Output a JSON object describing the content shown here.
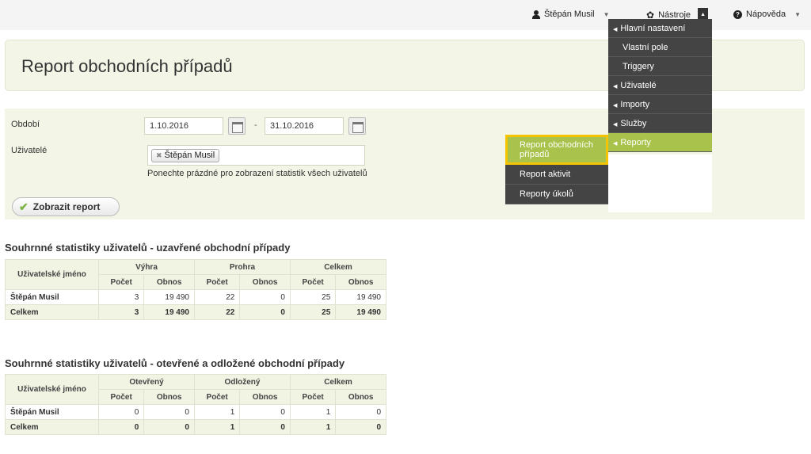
{
  "topbar": {
    "user_name": "Štěpán Musil",
    "tools_label": "Nástroje",
    "help_label": "Nápověda"
  },
  "page": {
    "title": "Report obchodních případů"
  },
  "filter": {
    "period_label": "Období",
    "date_from": "1.10.2016",
    "date_separator": "-",
    "date_to": "31.10.2016",
    "users_label": "Uživatelé",
    "selected_user": "Štěpán Musil",
    "hint": "Ponechte prázdné pro zobrazení statistik všech uživatelů",
    "submit_label": "Zobrazit report"
  },
  "tools_menu": {
    "items": [
      {
        "label": "Hlavní nastavení",
        "submenu": true
      },
      {
        "label": "Vlastní pole",
        "submenu": false
      },
      {
        "label": "Triggery",
        "submenu": false
      },
      {
        "label": "Uživatelé",
        "submenu": true
      },
      {
        "label": "Importy",
        "submenu": true
      },
      {
        "label": "Služby",
        "submenu": true
      },
      {
        "label": "Reporty",
        "submenu": true,
        "active": true
      }
    ],
    "reports_submenu": [
      {
        "label": "Report obchodních případů",
        "highlighted": true
      },
      {
        "label": "Report aktivit"
      },
      {
        "label": "Reporty úkolů"
      }
    ]
  },
  "table_closed": {
    "heading": "Souhrnné statistiky uživatelů - uzavřené obchodní případy",
    "col_user": "Uživatelské jméno",
    "groups": [
      "Výhra",
      "Prohra",
      "Celkem"
    ],
    "sub_cols": [
      "Počet",
      "Obnos"
    ],
    "rows": [
      {
        "name": "Štěpán Musil",
        "values": [
          "3",
          "19 490",
          "22",
          "0",
          "25",
          "19 490"
        ]
      },
      {
        "name": "Celkem",
        "values": [
          "3",
          "19 490",
          "22",
          "0",
          "25",
          "19 490"
        ]
      }
    ]
  },
  "table_open": {
    "heading": "Souhrnné statistiky uživatelů - otevřené a odložené obchodní případy",
    "col_user": "Uživatelské jméno",
    "groups": [
      "Otevřený",
      "Odložený",
      "Celkem"
    ],
    "sub_cols": [
      "Počet",
      "Obnos"
    ],
    "rows": [
      {
        "name": "Štěpán Musil",
        "values": [
          "0",
          "0",
          "1",
          "0",
          "1",
          "0"
        ]
      },
      {
        "name": "Celkem",
        "values": [
          "0",
          "0",
          "1",
          "0",
          "1",
          "0"
        ]
      }
    ]
  }
}
